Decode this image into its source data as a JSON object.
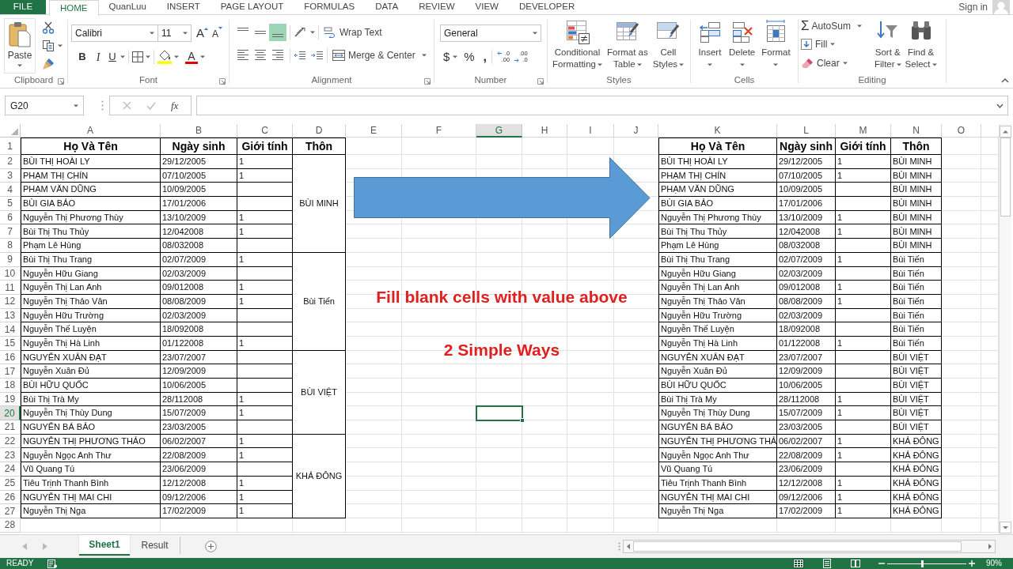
{
  "menu_tabs": [
    {
      "label": "FILE",
      "kind": "file",
      "selected": false
    },
    {
      "label": "HOME",
      "kind": "tab",
      "selected": true
    },
    {
      "label": "QuanLuu",
      "kind": "tab",
      "selected": false
    },
    {
      "label": "INSERT",
      "kind": "tab",
      "selected": false
    },
    {
      "label": "PAGE LAYOUT",
      "kind": "tab",
      "selected": false
    },
    {
      "label": "FORMULAS",
      "kind": "tab",
      "selected": false
    },
    {
      "label": "DATA",
      "kind": "tab",
      "selected": false
    },
    {
      "label": "REVIEW",
      "kind": "tab",
      "selected": false
    },
    {
      "label": "VIEW",
      "kind": "tab",
      "selected": false
    },
    {
      "label": "DEVELOPER",
      "kind": "tab",
      "selected": false
    }
  ],
  "account": {
    "label": "Sign in"
  },
  "ribbon": {
    "clipboard": {
      "title": "Clipboard",
      "paste": "Paste"
    },
    "font": {
      "title": "Font",
      "font_name": "Calibri",
      "font_size": "11",
      "grow_font": "A",
      "shrink_font": "A",
      "bold": "B",
      "italic": "I",
      "underline": "U",
      "font_color": "A"
    },
    "alignment": {
      "title": "Alignment",
      "vertical": [
        {
          "kind": "top",
          "selected": false
        },
        {
          "kind": "middle",
          "selected": false
        },
        {
          "kind": "bottom",
          "selected": true
        }
      ],
      "horizontal": [
        {
          "kind": "left",
          "selected": false
        },
        {
          "kind": "center",
          "selected": false
        },
        {
          "kind": "right",
          "selected": false
        }
      ],
      "wrap_text": "Wrap Text",
      "merge_center": "Merge & Center"
    },
    "number": {
      "title": "Number",
      "format": "General",
      "currency": "$",
      "percent": "%",
      "comma": ",",
      "increase_decimal": [
        ".0",
        ".00"
      ],
      "decrease_decimal": [
        ".00",
        ".0"
      ]
    },
    "styles": {
      "title": "Styles",
      "buttons": [
        {
          "kind": "conditional",
          "lines": [
            "Conditional",
            "Formatting"
          ]
        },
        {
          "kind": "table",
          "lines": [
            "Format as",
            "Table"
          ]
        },
        {
          "kind": "cell_styles",
          "lines": [
            "Cell",
            "Styles"
          ]
        }
      ]
    },
    "cells": {
      "title": "Cells",
      "buttons": [
        {
          "kind": "insert",
          "label": "Insert"
        },
        {
          "kind": "delete",
          "label": "Delete"
        },
        {
          "kind": "format",
          "label": "Format"
        }
      ]
    },
    "editing": {
      "title": "Editing",
      "autosum_symbol": "Σ",
      "autosum": "AutoSum",
      "fill": "Fill",
      "clear": "Clear",
      "big_buttons": [
        {
          "kind": "sort",
          "lines": [
            "Sort &",
            "Filter"
          ]
        },
        {
          "kind": "find",
          "lines": [
            "Find &",
            "Select"
          ]
        }
      ]
    }
  },
  "formula_bar": {
    "name_box": "G20",
    "function_label": "fx"
  },
  "sheet": {
    "columns": [
      {
        "label": "A",
        "selected": false
      },
      {
        "label": "B",
        "selected": false
      },
      {
        "label": "C",
        "selected": false
      },
      {
        "label": "D",
        "selected": false
      },
      {
        "label": "E",
        "selected": false
      },
      {
        "label": "F",
        "selected": false
      },
      {
        "label": "G",
        "selected": true
      },
      {
        "label": "H",
        "selected": false
      },
      {
        "label": "I",
        "selected": false
      },
      {
        "label": "J",
        "selected": false
      },
      {
        "label": "K",
        "selected": false
      },
      {
        "label": "L",
        "selected": false
      },
      {
        "label": "M",
        "selected": false
      },
      {
        "label": "N",
        "selected": false
      },
      {
        "label": "O",
        "selected": false
      }
    ],
    "rows": [
      {
        "label": "1",
        "selected": false
      },
      {
        "label": "2",
        "selected": false
      },
      {
        "label": "3",
        "selected": false
      },
      {
        "label": "4",
        "selected": false
      },
      {
        "label": "5",
        "selected": false
      },
      {
        "label": "6",
        "selected": false
      },
      {
        "label": "7",
        "selected": false
      },
      {
        "label": "8",
        "selected": false
      },
      {
        "label": "9",
        "selected": false
      },
      {
        "label": "10",
        "selected": false
      },
      {
        "label": "11",
        "selected": false
      },
      {
        "label": "12",
        "selected": false
      },
      {
        "label": "13",
        "selected": false
      },
      {
        "label": "14",
        "selected": false
      },
      {
        "label": "15",
        "selected": false
      },
      {
        "label": "16",
        "selected": false
      },
      {
        "label": "17",
        "selected": false
      },
      {
        "label": "18",
        "selected": false
      },
      {
        "label": "19",
        "selected": false
      },
      {
        "label": "20",
        "selected": true
      },
      {
        "label": "21",
        "selected": false
      },
      {
        "label": "22",
        "selected": false
      },
      {
        "label": "23",
        "selected": false
      },
      {
        "label": "24",
        "selected": false
      },
      {
        "label": "25",
        "selected": false
      },
      {
        "label": "26",
        "selected": false
      },
      {
        "label": "27",
        "selected": false
      },
      {
        "label": "28",
        "selected": false
      }
    ],
    "source_table": {
      "headers": [
        "Họ Và Tên",
        "Ngày sinh",
        "Giới tính",
        "Thôn"
      ],
      "groups": [
        {
          "village": "BÙI MINH",
          "rows": [
            {
              "name": "BÙI THỊ HOÀI LY",
              "birth_date": "29/12/2005",
              "gender": "1"
            },
            {
              "name": "PHẠM THỊ CHÍN",
              "birth_date": "07/10/2005",
              "gender": "1"
            },
            {
              "name": "PHẠM VĂN DŨNG",
              "birth_date": "10/09/2005"
            },
            {
              "name": "BÙI GIA BẢO",
              "birth_date": "17/01/2006"
            },
            {
              "name": "Nguyễn Thị Phương Thùy",
              "birth_date": "13/10/2009",
              "gender": "1"
            },
            {
              "name": "Bùi Thị Thu Thủy",
              "birth_date": "12/042008",
              "gender": "1"
            },
            {
              "name": "Phạm Lê Hùng",
              "birth_date": "08/032008"
            }
          ]
        },
        {
          "village": "Bùi Tiến",
          "rows": [
            {
              "name": "Bùi Thị Thu Trang",
              "birth_date": "02/07/2009",
              "gender": "1"
            },
            {
              "name": "Nguyễn Hữu Giang",
              "birth_date": "02/03/2009"
            },
            {
              "name": "Nguyễn Thị Lan Anh",
              "birth_date": "09/012008",
              "gender": "1"
            },
            {
              "name": "Nguyễn Thị Thảo Vân",
              "birth_date": "08/08/2009",
              "gender": "1"
            },
            {
              "name": "Nguyễn Hữu Trường",
              "birth_date": "02/03/2009"
            },
            {
              "name": "Nguyễn Thế Luyện",
              "birth_date": "18/092008"
            },
            {
              "name": "Nguyễn Thị Hà Linh",
              "birth_date": "01/122008",
              "gender": "1"
            }
          ]
        },
        {
          "village": "BÙI VIỆT",
          "rows": [
            {
              "name": "NGUYỄN XUÂN ĐẠT",
              "birth_date": "23/07/2007"
            },
            {
              "name": "Nguyễn Xuân Đủ",
              "birth_date": "12/09/2009"
            },
            {
              "name": "BÙI HỮU QUỐC",
              "birth_date": "10/06/2005"
            },
            {
              "name": "Bùi Thị Trà My",
              "birth_date": "28/112008",
              "gender": "1"
            },
            {
              "name": "Nguyễn Thị Thùy Dung",
              "birth_date": "15/07/2009",
              "gender": "1"
            },
            {
              "name": "NGUYỄN BÁ BẢO",
              "birth_date": "23/03/2005"
            }
          ]
        },
        {
          "village": "KHẢ ĐÔNG",
          "rows": [
            {
              "name": "NGUYỄN THỊ PHƯƠNG THẢO",
              "birth_date": "06/02/2007",
              "gender": "1"
            },
            {
              "name": "Nguyễn Ngọc Anh Thư",
              "birth_date": "22/08/2009",
              "gender": "1"
            },
            {
              "name": "Vũ Quang Tú",
              "birth_date": "23/06/2009"
            },
            {
              "name": "Tiêu Trịnh Thanh Bình",
              "birth_date": "12/12/2008",
              "gender": "1"
            },
            {
              "name": "NGUYỄN THỊ MAI CHI",
              "birth_date": "09/12/2006",
              "gender": "1"
            },
            {
              "name": "Nguyễn Thị Nga",
              "birth_date": "17/02/2009",
              "gender": "1"
            }
          ]
        }
      ]
    },
    "result_table": {
      "headers": [
        "Họ Và Tên",
        "Ngày sinh",
        "Giới tính",
        "Thôn"
      ],
      "rows": [
        {
          "name": "BÙI THỊ HOÀI LY",
          "birth_date": "29/12/2005",
          "gender": "1",
          "village": "BÙI MINH"
        },
        {
          "name": "PHẠM THỊ CHÍN",
          "birth_date": "07/10/2005",
          "gender": "1",
          "village": "BÙI MINH"
        },
        {
          "name": "PHẠM VĂN DŨNG",
          "birth_date": "10/09/2005",
          "village": "BÙI MINH"
        },
        {
          "name": "BÙI GIA BẢO",
          "birth_date": "17/01/2006",
          "village": "BÙI MINH"
        },
        {
          "name": "Nguyễn Thị Phương Thùy",
          "birth_date": "13/10/2009",
          "gender": "1",
          "village": "BÙI MINH"
        },
        {
          "name": "Bùi Thị Thu Thủy",
          "birth_date": "12/042008",
          "gender": "1",
          "village": "BÙI MINH"
        },
        {
          "name": "Phạm Lê Hùng",
          "birth_date": "08/032008",
          "village": "BÙI MINH"
        },
        {
          "name": "Bùi Thị Thu Trang",
          "birth_date": "02/07/2009",
          "gender": "1",
          "village": "Bùi Tiến"
        },
        {
          "name": "Nguyễn Hữu Giang",
          "birth_date": "02/03/2009",
          "village": "Bùi Tiến"
        },
        {
          "name": "Nguyễn Thị Lan Anh",
          "birth_date": "09/012008",
          "gender": "1",
          "village": "Bùi Tiến"
        },
        {
          "name": "Nguyễn Thị Thảo Vân",
          "birth_date": "08/08/2009",
          "gender": "1",
          "village": "Bùi Tiến"
        },
        {
          "name": "Nguyễn Hữu Trường",
          "birth_date": "02/03/2009",
          "village": "Bùi Tiến"
        },
        {
          "name": "Nguyễn Thế Luyện",
          "birth_date": "18/092008",
          "village": "Bùi Tiến"
        },
        {
          "name": "Nguyễn Thị Hà Linh",
          "birth_date": "01/122008",
          "gender": "1",
          "village": "Bùi Tiến"
        },
        {
          "name": "NGUYỄN XUÂN ĐẠT",
          "birth_date": "23/07/2007",
          "village": "BÙI VIỆT"
        },
        {
          "name": "Nguyễn Xuân Đủ",
          "birth_date": "12/09/2009",
          "village": "BÙI VIỆT"
        },
        {
          "name": "BÙI HỮU QUỐC",
          "birth_date": "10/06/2005",
          "village": "BÙI VIỆT"
        },
        {
          "name": "Bùi Thị Trà My",
          "birth_date": "28/112008",
          "gender": "1",
          "village": "BÙI VIỆT"
        },
        {
          "name": "Nguyễn Thị Thùy Dung",
          "birth_date": "15/07/2009",
          "gender": "1",
          "village": "BÙI VIỆT"
        },
        {
          "name": "NGUYỄN BÁ BẢO",
          "birth_date": "23/03/2005",
          "village": "BÙI VIỆT"
        },
        {
          "name": "NGUYỄN THỊ PHƯƠNG THẢ",
          "birth_date": "06/02/2007",
          "gender": "1",
          "village": "KHẢ ĐÔNG"
        },
        {
          "name": "Nguyễn Ngọc Anh Thư",
          "birth_date": "22/08/2009",
          "gender": "1",
          "village": "KHẢ ĐÔNG"
        },
        {
          "name": "Vũ Quang Tú",
          "birth_date": "23/06/2009",
          "village": "KHẢ ĐÔNG"
        },
        {
          "name": "Tiêu Trịnh Thanh Bình",
          "birth_date": "12/12/2008",
          "gender": "1",
          "village": "KHẢ ĐÔNG"
        },
        {
          "name": "NGUYỄN THỊ MAI CHI",
          "birth_date": "09/12/2006",
          "gender": "1",
          "village": "KHẢ ĐÔNG"
        },
        {
          "name": "Nguyễn Thị Nga",
          "birth_date": "17/02/2009",
          "gender": "1",
          "village": "KHẢ ĐÔNG"
        }
      ]
    },
    "note_lines": [
      "Fill blank cells with value above",
      "2 Simple Ways"
    ]
  },
  "sheet_tabs": [
    {
      "label": "Sheet1",
      "selected": true
    },
    {
      "label": "Result",
      "selected": false
    }
  ],
  "status_bar": {
    "mode": "READY",
    "views": [
      {
        "kind": "normal",
        "selected": true
      },
      {
        "kind": "page_layout",
        "selected": false
      },
      {
        "kind": "page_break",
        "selected": false
      }
    ],
    "zoom_slider": {
      "level": 0.44
    },
    "zoom": "90%"
  }
}
